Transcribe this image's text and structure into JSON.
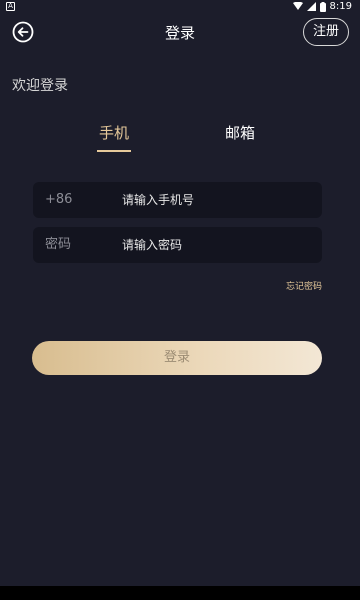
{
  "status_bar": {
    "left_icon": "A",
    "time": "8:19"
  },
  "header": {
    "title": "登录",
    "register_label": "注册"
  },
  "welcome_text": "欢迎登录",
  "tabs": [
    {
      "label": "手机",
      "active": true
    },
    {
      "label": "邮箱",
      "active": false
    }
  ],
  "phone_field": {
    "prefix": "+86",
    "placeholder": "请输入手机号",
    "value": ""
  },
  "password_field": {
    "prefix": "密码",
    "placeholder": "请输入密码",
    "value": ""
  },
  "forgot_label": "忘记密码",
  "login_label": "登录",
  "colors": {
    "background": "#1c1d2b",
    "accent": "#e6c99b",
    "field_bg": "#13141f"
  }
}
